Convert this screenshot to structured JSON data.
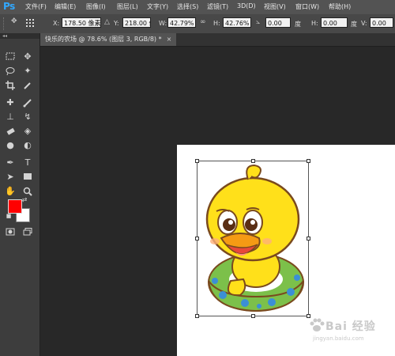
{
  "app": {
    "logo": "Ps"
  },
  "menu": [
    "文件(F)",
    "编辑(E)",
    "图像(I)",
    "图层(L)",
    "文字(Y)",
    "选择(S)",
    "滤镜(T)",
    "3D(D)",
    "视图(V)",
    "窗口(W)",
    "帮助(H)"
  ],
  "options": {
    "x_label": "X:",
    "x_value": "178.50 像素",
    "y_label": "Y:",
    "y_value": "218.00 像素",
    "w_label": "W:",
    "w_value": "42.79%",
    "h_label": "H:",
    "h_value": "42.76%",
    "angle_value": "0.00",
    "angle_unit": "度",
    "hskew_label": "H:",
    "hskew_value": "0.00",
    "hskew_unit": "度",
    "vskew_label": "V:",
    "vskew_value": "0.00"
  },
  "document_tab": {
    "title": "快乐的农场 @ 78.6% (图层 3, RGB/8) *",
    "close": "×"
  },
  "toolbox": {
    "collapse": "◂◂"
  },
  "watermark": {
    "text": "Bai 经验",
    "url": "jingyan.baidu.com"
  },
  "colors": {
    "foreground": "#ff0000",
    "background": "#ffffff",
    "workspace": "#282828",
    "accent": "#31a8ff"
  }
}
